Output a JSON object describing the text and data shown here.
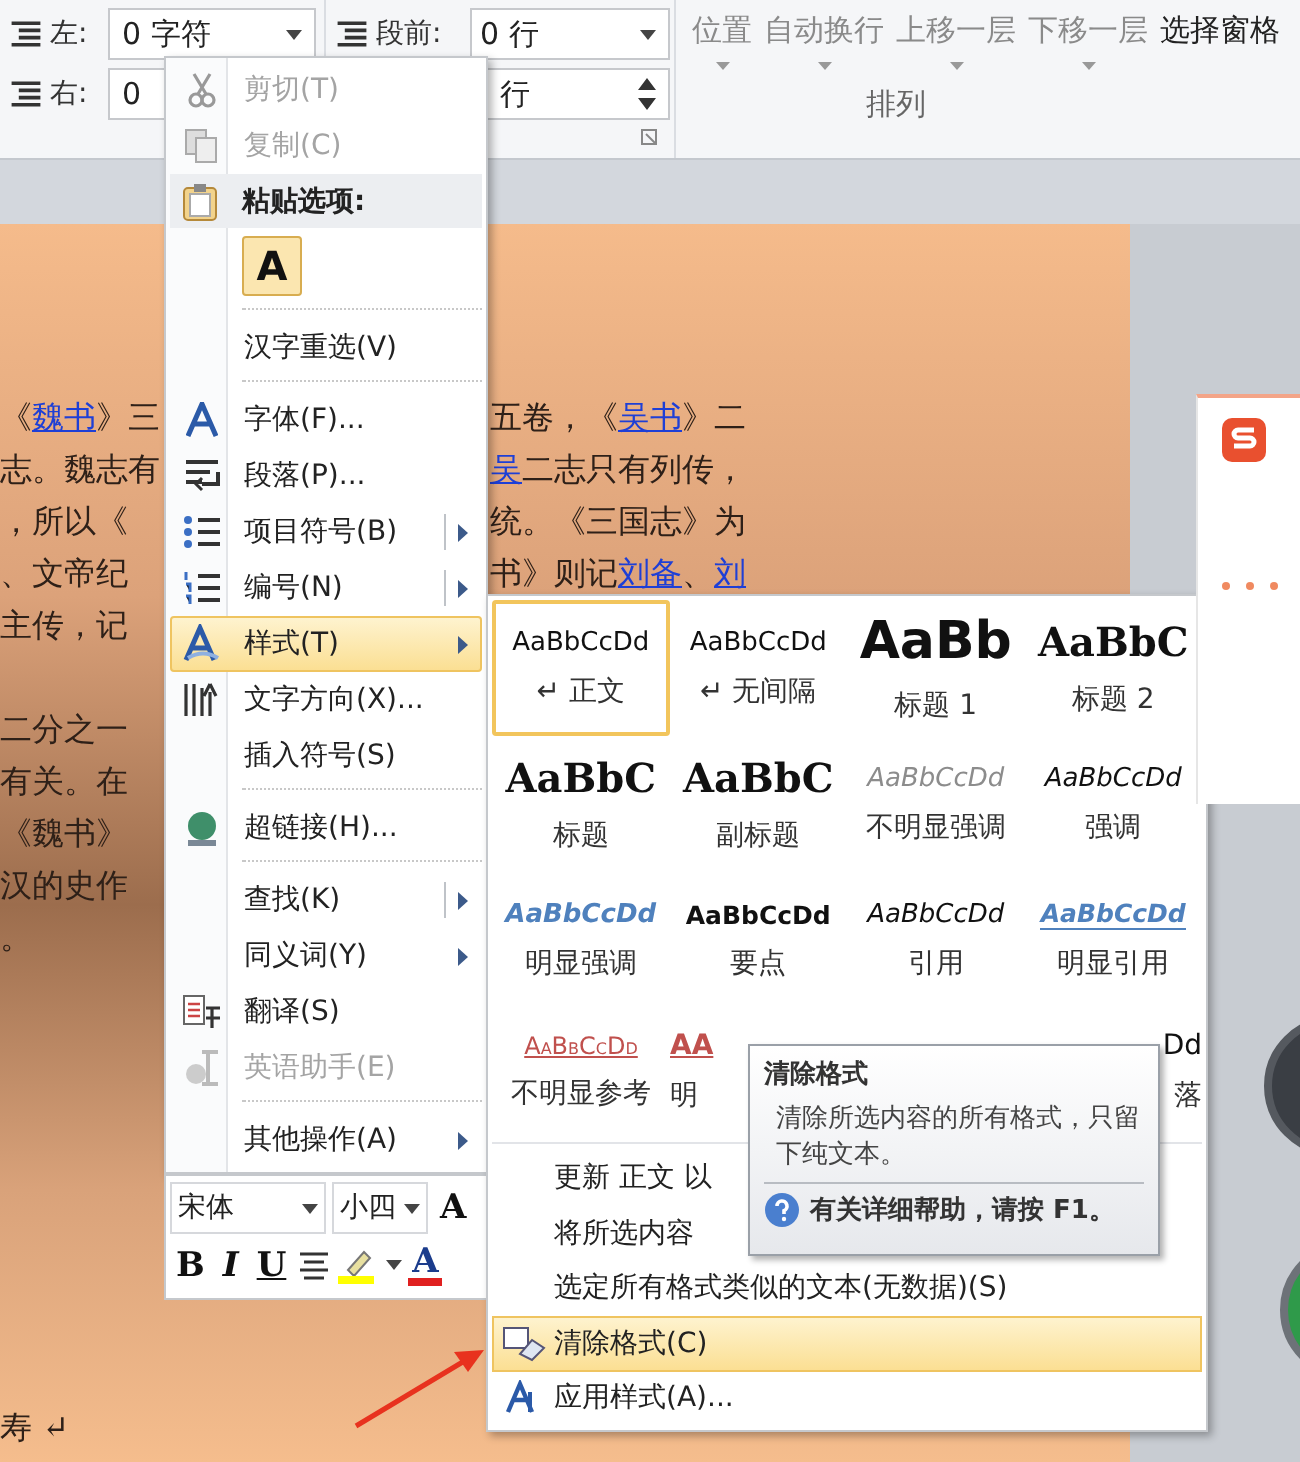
{
  "ribbon": {
    "indent": [
      {
        "label": "左:",
        "value": "0 字符"
      },
      {
        "label": "右:",
        "value": "0"
      }
    ],
    "spacing": [
      {
        "label": "段前:",
        "value": "0 行",
        "kind": "dropdown"
      },
      {
        "value": "行",
        "kind": "spinner"
      }
    ],
    "arrange_buttons": [
      {
        "label": "位置",
        "disabled": true,
        "dropdown": true
      },
      {
        "label": "自动换行",
        "disabled": true,
        "dropdown": true
      },
      {
        "label": "上移一层",
        "disabled": true,
        "dropdown": true
      },
      {
        "label": "下移一层",
        "disabled": true,
        "dropdown": true
      },
      {
        "label": "选择窗格",
        "disabled": false,
        "dropdown": false
      }
    ],
    "arrange_label": "排列"
  },
  "document": {
    "lines": [
      {
        "left": [
          {
            "text": "《",
            "link": false
          },
          {
            "text": "魏书",
            "link": true
          },
          {
            "text": "》三",
            "link": false
          }
        ],
        "right": [
          {
            "text": "五卷，《",
            "link": false
          },
          {
            "text": "吴书",
            "link": true
          },
          {
            "text": "》二",
            "link": false
          }
        ]
      },
      {
        "left": [
          {
            "text": "志。魏志有",
            "link": false
          }
        ],
        "right": [
          {
            "text": "吴",
            "link": true
          },
          {
            "text": "二志只有列传，",
            "link": false
          }
        ]
      },
      {
        "left": [
          {
            "text": "，所以《",
            "link": false
          }
        ],
        "right": [
          {
            "text": "统。《三国志》为",
            "link": false
          }
        ]
      },
      {
        "left": [
          {
            "text": "、文帝纪",
            "link": false
          }
        ],
        "right": [
          {
            "text": "书》则记",
            "link": false
          },
          {
            "text": "刘备",
            "link": true
          },
          {
            "text": "、",
            "link": false
          },
          {
            "text": "刘",
            "link": true
          }
        ]
      },
      {
        "left": [
          {
            "text": "主传，记",
            "link": false
          }
        ]
      },
      {
        "kind": "new_paragraph",
        "left": [
          {
            "text": "二分之一",
            "link": false
          }
        ]
      },
      {
        "left": [
          {
            "text": "有关。在",
            "link": false
          }
        ]
      },
      {
        "left": [
          {
            "text": "《魏书》",
            "link": false
          }
        ]
      },
      {
        "left": [
          {
            "text": "汉的史作",
            "link": false
          }
        ]
      },
      {
        "left": [
          {
            "text": "。",
            "link": false
          }
        ]
      }
    ],
    "last_line": "寿 ↵"
  },
  "context_menu": {
    "items": [
      {
        "kind": "action",
        "label": "剪切(T)",
        "disabled": true,
        "selected": false
      },
      {
        "kind": "action",
        "label": "复制(C)",
        "disabled": true,
        "selected": false
      },
      {
        "kind": "header",
        "label": "粘贴选项:"
      },
      {
        "kind": "paste",
        "label": "A"
      },
      {
        "kind": "separator"
      },
      {
        "kind": "action",
        "label": "汉字重选(V)",
        "disabled": false,
        "selected": false
      },
      {
        "kind": "separator"
      },
      {
        "kind": "action",
        "label": "字体(F)...",
        "disabled": false,
        "selected": false
      },
      {
        "kind": "action",
        "label": "段落(P)...",
        "disabled": false,
        "selected": false
      },
      {
        "kind": "action",
        "label": "项目符号(B)",
        "disabled": false,
        "selected": false,
        "submenu": true,
        "split": true
      },
      {
        "kind": "action",
        "label": "编号(N)",
        "disabled": false,
        "selected": false,
        "submenu": true,
        "split": true
      },
      {
        "kind": "action",
        "label": "样式(T)",
        "disabled": false,
        "selected": true,
        "submenu": true,
        "split": false
      },
      {
        "kind": "action",
        "label": "文字方向(X)...",
        "disabled": false,
        "selected": false
      },
      {
        "kind": "action",
        "label": "插入符号(S)",
        "disabled": false,
        "selected": false
      },
      {
        "kind": "separator"
      },
      {
        "kind": "action",
        "label": "超链接(H)...",
        "disabled": false,
        "selected": false
      },
      {
        "kind": "separator"
      },
      {
        "kind": "action",
        "label": "查找(K)",
        "disabled": false,
        "selected": false,
        "submenu": true,
        "split": true
      },
      {
        "kind": "action",
        "label": "同义词(Y)",
        "disabled": false,
        "selected": false,
        "submenu": true,
        "split": false
      },
      {
        "kind": "action",
        "label": "翻译(S)",
        "disabled": false,
        "selected": false
      },
      {
        "kind": "action",
        "label": "英语助手(E)",
        "disabled": true,
        "selected": false
      },
      {
        "kind": "separator"
      },
      {
        "kind": "action",
        "label": "其他操作(A)",
        "disabled": false,
        "selected": false,
        "submenu": true,
        "split": false
      }
    ]
  },
  "mini_toolbar": {
    "font": "宋体",
    "size": "小四",
    "grow_font": "A",
    "bold": "B",
    "italic": "I",
    "underline": "U",
    "font_color": "A"
  },
  "styles_menu": {
    "gallery": [
      {
        "kind": "normal",
        "sample": "AaBbCcDd",
        "label": "↵ 正文",
        "selected": true
      },
      {
        "kind": "no_spacing",
        "sample": "AaBbCcDd",
        "label": "↵ 无间隔",
        "selected": false
      },
      {
        "kind": "heading1",
        "sample": "AaBb",
        "label": "标题 1",
        "selected": false
      },
      {
        "kind": "heading2",
        "sample": "AaBbC",
        "label": "标题 2",
        "selected": false
      },
      {
        "kind": "title",
        "sample": "AaBbC",
        "label": "标题",
        "selected": false
      },
      {
        "kind": "subtitle",
        "sample": "AaBbC",
        "label": "副标题",
        "selected": false
      },
      {
        "kind": "subtle_emphasis",
        "sample": "AaBbCcDd",
        "label": "不明显强调",
        "selected": false
      },
      {
        "kind": "emphasis",
        "sample": "AaBbCcDd",
        "label": "强调",
        "selected": false
      },
      {
        "kind": "intense_emphasis",
        "sample": "AaBbCcDd",
        "label": "明显强调",
        "selected": false
      },
      {
        "kind": "strong",
        "sample": "AaBbCcDd",
        "label": "要点",
        "selected": false
      },
      {
        "kind": "quote",
        "sample": "AaBbCcDd",
        "label": "引用",
        "selected": false
      },
      {
        "kind": "intense_quote",
        "sample": "AaBbCcDd",
        "label": "明显引用",
        "selected": false
      }
    ],
    "gallery_partial_row": [
      {
        "kind": "subtle_reference",
        "sample": "AaBbCcDd",
        "label": "不明显参考"
      },
      {
        "kind": "intense_reference",
        "sample": "AA",
        "label": "明"
      },
      {
        "kind": "list_paragraph",
        "sample": "Dd",
        "label": "落"
      }
    ],
    "items": [
      {
        "label": "更新 正文 以",
        "selected": false
      },
      {
        "label": "将所选内容",
        "selected": false
      },
      {
        "label": "选定所有格式类似的文本(无数据)(S)",
        "selected": false
      },
      {
        "label": "清除格式(C)",
        "selected": true
      },
      {
        "label": "应用样式(A)...",
        "selected": false
      }
    ]
  },
  "tooltip": {
    "title": "清除格式",
    "body": "清除所选内容的所有格式，只留下纯文本。",
    "help": "有关详细帮助，请按 F1。"
  }
}
